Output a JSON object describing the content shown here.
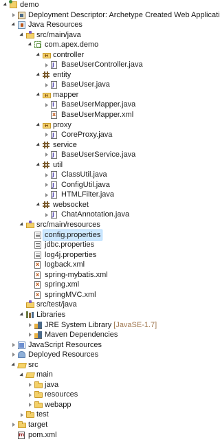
{
  "tree": [
    {
      "depth": 0,
      "toggle": "expanded",
      "icon": "project-icon",
      "label": "demo"
    },
    {
      "depth": 1,
      "toggle": "collapsed",
      "icon": "deployment-descriptor-icon",
      "label": "Deployment Descriptor: Archetype Created Web Application"
    },
    {
      "depth": 1,
      "toggle": "expanded",
      "icon": "java-resources-icon",
      "label": "Java Resources"
    },
    {
      "depth": 2,
      "toggle": "expanded",
      "icon": "source-folder-icon",
      "label": "src/main/java"
    },
    {
      "depth": 3,
      "toggle": "expanded",
      "icon": "package-empty-icon",
      "label": "com.apex.demo"
    },
    {
      "depth": 4,
      "toggle": "expanded",
      "icon": "package-folder-icon",
      "label": "controller"
    },
    {
      "depth": 5,
      "toggle": "collapsed",
      "icon": "java-file-icon",
      "label": "BaseUserController.java"
    },
    {
      "depth": 4,
      "toggle": "expanded",
      "icon": "package-icon",
      "label": "entity"
    },
    {
      "depth": 5,
      "toggle": "collapsed",
      "icon": "java-file-icon",
      "label": "BaseUser.java"
    },
    {
      "depth": 4,
      "toggle": "expanded",
      "icon": "package-folder-icon",
      "label": "mapper"
    },
    {
      "depth": 5,
      "toggle": "collapsed",
      "icon": "java-interface-icon",
      "label": "BaseUserMapper.java"
    },
    {
      "depth": 5,
      "toggle": "none",
      "icon": "xml-file-icon",
      "label": "BaseUserMapper.xml"
    },
    {
      "depth": 4,
      "toggle": "expanded",
      "icon": "package-folder-icon",
      "label": "proxy"
    },
    {
      "depth": 5,
      "toggle": "collapsed",
      "icon": "java-file-icon",
      "label": "CoreProxy.java"
    },
    {
      "depth": 4,
      "toggle": "expanded",
      "icon": "package-icon",
      "label": "service"
    },
    {
      "depth": 5,
      "toggle": "collapsed",
      "icon": "java-file-icon",
      "label": "BaseUserService.java"
    },
    {
      "depth": 4,
      "toggle": "expanded",
      "icon": "package-icon",
      "label": "util"
    },
    {
      "depth": 5,
      "toggle": "collapsed",
      "icon": "java-file-icon",
      "label": "ClassUtil.java"
    },
    {
      "depth": 5,
      "toggle": "collapsed",
      "icon": "java-file-icon",
      "label": "ConfigUtil.java"
    },
    {
      "depth": 5,
      "toggle": "collapsed",
      "icon": "java-file-icon",
      "label": "HTMLFilter.java"
    },
    {
      "depth": 4,
      "toggle": "expanded",
      "icon": "package-icon",
      "label": "websocket"
    },
    {
      "depth": 5,
      "toggle": "collapsed",
      "icon": "java-file-icon",
      "label": "ChatAnnotation.java"
    },
    {
      "depth": 2,
      "toggle": "expanded",
      "icon": "source-folder-icon",
      "label": "src/main/resources"
    },
    {
      "depth": 3,
      "toggle": "none",
      "icon": "properties-file-icon",
      "label": "config.properties",
      "selected": true
    },
    {
      "depth": 3,
      "toggle": "none",
      "icon": "properties-file-icon",
      "label": "jdbc.properties"
    },
    {
      "depth": 3,
      "toggle": "none",
      "icon": "properties-file-icon",
      "label": "log4j.properties"
    },
    {
      "depth": 3,
      "toggle": "none",
      "icon": "xml-file-icon",
      "label": "logback.xml"
    },
    {
      "depth": 3,
      "toggle": "none",
      "icon": "xml-file-icon",
      "label": "spring-mybatis.xml"
    },
    {
      "depth": 3,
      "toggle": "none",
      "icon": "xml-file-icon",
      "label": "spring.xml"
    },
    {
      "depth": 3,
      "toggle": "none",
      "icon": "xml-file-icon",
      "label": "springMVC.xml"
    },
    {
      "depth": 2,
      "toggle": "none",
      "icon": "source-folder-icon",
      "label": "src/test/java"
    },
    {
      "depth": 2,
      "toggle": "expanded",
      "icon": "libraries-icon",
      "label": "Libraries"
    },
    {
      "depth": 3,
      "toggle": "collapsed",
      "icon": "library-icon",
      "label": "JRE System Library",
      "decoration": "[JavaSE-1.7]"
    },
    {
      "depth": 3,
      "toggle": "collapsed",
      "icon": "library-icon",
      "label": "Maven Dependencies"
    },
    {
      "depth": 1,
      "toggle": "collapsed",
      "icon": "javascript-resources-icon",
      "label": "JavaScript Resources"
    },
    {
      "depth": 1,
      "toggle": "collapsed",
      "icon": "deployed-resources-icon",
      "label": "Deployed Resources"
    },
    {
      "depth": 1,
      "toggle": "expanded",
      "icon": "folder-open-icon",
      "label": "src"
    },
    {
      "depth": 2,
      "toggle": "expanded",
      "icon": "folder-open-icon",
      "label": "main"
    },
    {
      "depth": 3,
      "toggle": "collapsed",
      "icon": "folder-icon",
      "label": "java"
    },
    {
      "depth": 3,
      "toggle": "collapsed",
      "icon": "folder-icon",
      "label": "resources"
    },
    {
      "depth": 3,
      "toggle": "collapsed",
      "icon": "folder-icon",
      "label": "webapp"
    },
    {
      "depth": 2,
      "toggle": "collapsed",
      "icon": "folder-icon",
      "label": "test"
    },
    {
      "depth": 1,
      "toggle": "collapsed",
      "icon": "folder-icon",
      "label": "target"
    },
    {
      "depth": 1,
      "toggle": "none",
      "icon": "pom-file-icon",
      "label": "pom.xml"
    }
  ]
}
